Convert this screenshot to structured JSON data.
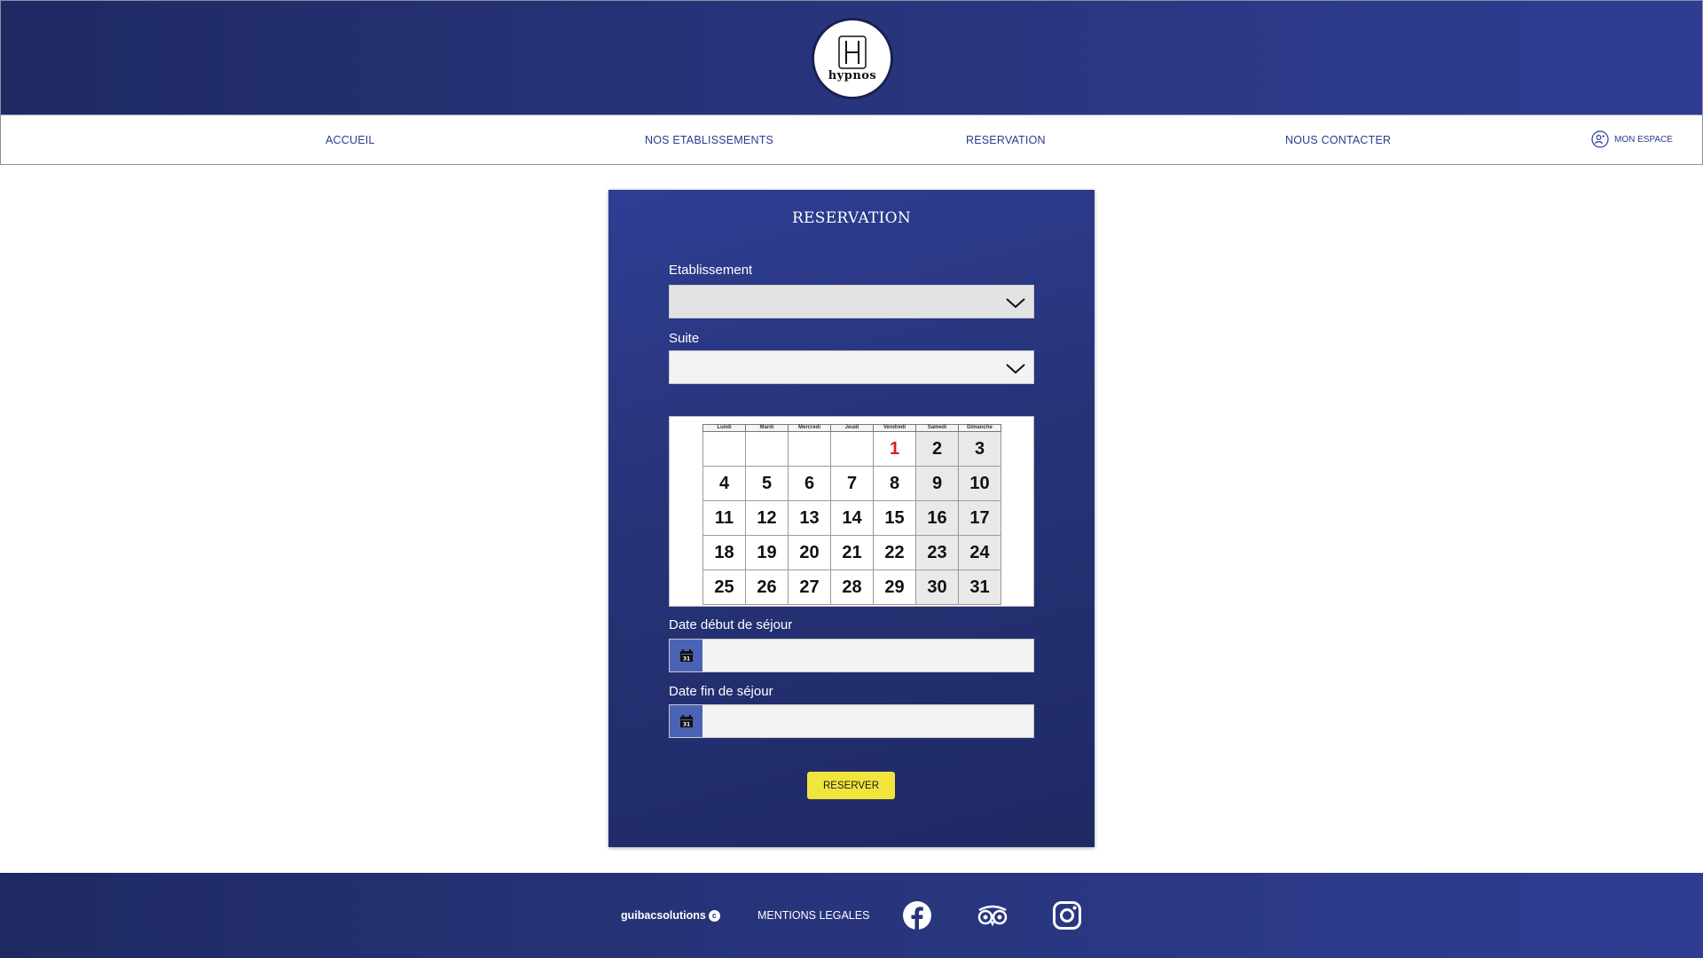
{
  "header": {
    "logo_text": "hypnos",
    "logo_letter": "H"
  },
  "nav": {
    "items": [
      {
        "label": "ACCUEIL"
      },
      {
        "label": "NOS ETABLISSEMENTS"
      },
      {
        "label": "RESERVATION"
      },
      {
        "label": "NOUS CONTACTER"
      }
    ],
    "account_label": "MON ESPACE"
  },
  "form": {
    "title": "RESERVATION",
    "etablissement_label": "Etablissement",
    "etablissement_value": "",
    "suite_label": "Suite",
    "suite_value": "",
    "start_label": "Date début de séjour",
    "start_value": "",
    "end_label": "Date fin de séjour",
    "end_value": "",
    "calendar_icon_number": "31",
    "submit_label": "RESERVER"
  },
  "calendar": {
    "weekdays": [
      "Lundi",
      "Mardi",
      "Mercredi",
      "Jeudi",
      "Vendredi",
      "Samedi",
      "Dimanche"
    ],
    "weeks": [
      [
        "",
        "",
        "",
        "",
        "1",
        "2",
        "3"
      ],
      [
        "4",
        "5",
        "6",
        "7",
        "8",
        "9",
        "10"
      ],
      [
        "11",
        "12",
        "13",
        "14",
        "15",
        "16",
        "17"
      ],
      [
        "18",
        "19",
        "20",
        "21",
        "22",
        "23",
        "24"
      ],
      [
        "25",
        "26",
        "27",
        "28",
        "29",
        "30",
        "31"
      ]
    ],
    "highlight_day": "1",
    "highlight_color": "#e01b1b",
    "weekend_shade": "#e9e9e9"
  },
  "footer": {
    "brand": "guibacsolutions",
    "copyright_mark": "c",
    "legal_label": "MENTIONS LEGALES",
    "social": [
      "facebook-icon",
      "tripadvisor-icon",
      "instagram-icon"
    ]
  },
  "colors": {
    "brand_navy": "#27347a",
    "accent_yellow": "#f1e43c",
    "nav_text": "#2b3a8c"
  }
}
